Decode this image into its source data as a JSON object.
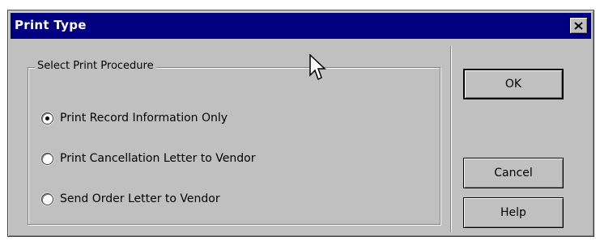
{
  "window": {
    "title": "Print Type",
    "close_label": "Close"
  },
  "group": {
    "legend": "Select Print Procedure",
    "options": [
      {
        "label": "Print Record Information Only",
        "selected": true
      },
      {
        "label": "Print Cancellation Letter to Vendor",
        "selected": false
      },
      {
        "label": "Send Order Letter to Vendor",
        "selected": false
      }
    ]
  },
  "buttons": {
    "ok": "OK",
    "cancel": "Cancel",
    "help": "Help"
  },
  "colors": {
    "titlebar": "#000080",
    "face": "#c0c0c0",
    "title_text": "#ffffff"
  }
}
